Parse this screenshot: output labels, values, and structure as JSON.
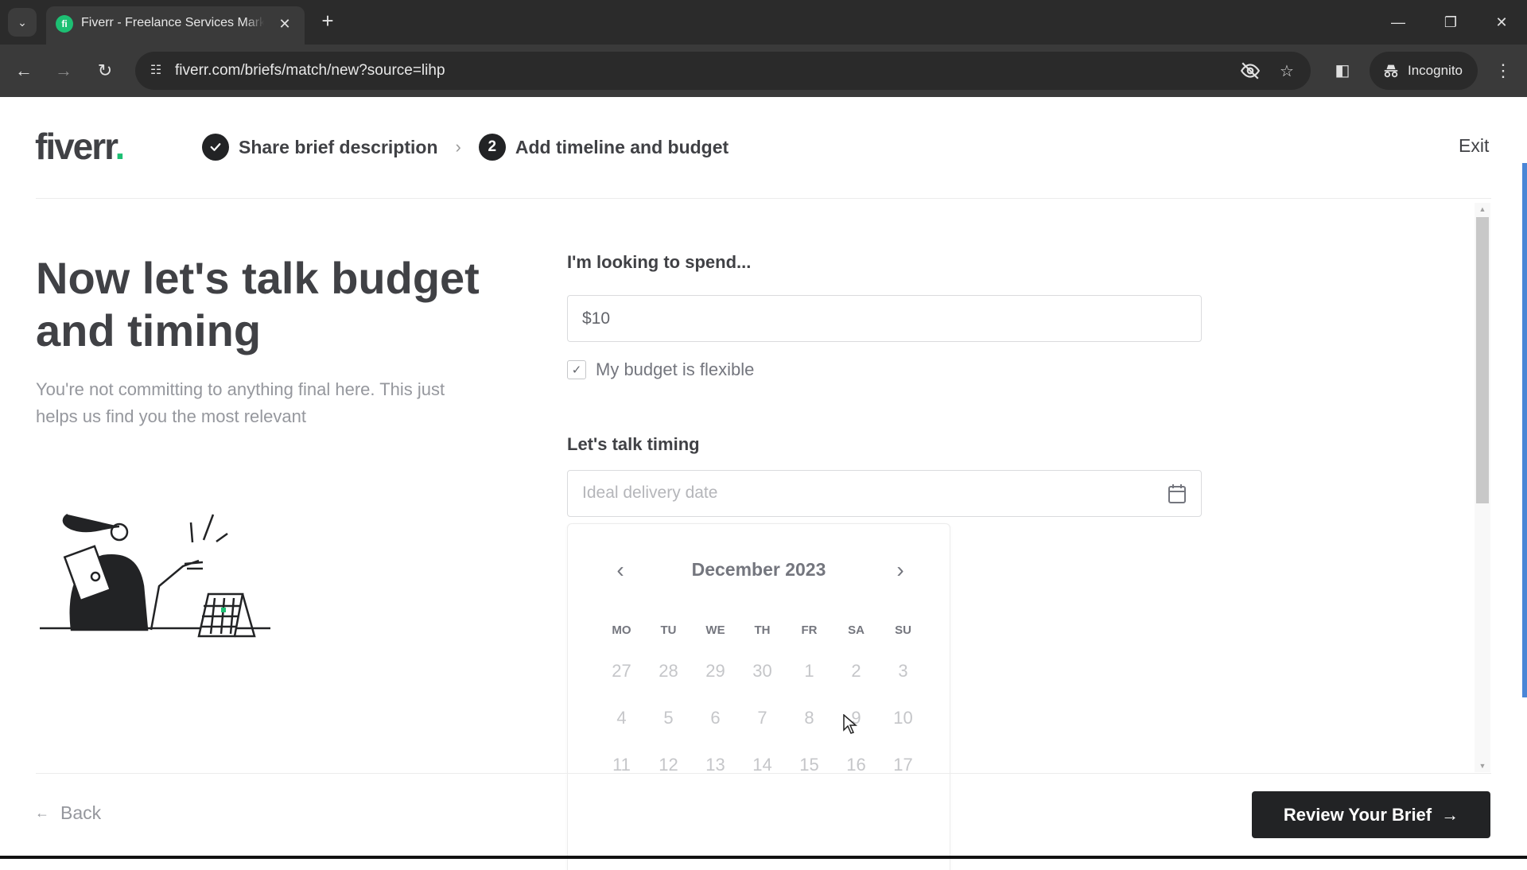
{
  "browser": {
    "tab_title": "Fiverr - Freelance Services Marketplace",
    "favicon_letter": "fi",
    "url": "fiverr.com/briefs/match/new?source=lihp",
    "profile_label": "Incognito",
    "icons": {
      "tab_list": "chevron-down-icon",
      "close_tab": "close-icon",
      "new_tab": "plus-icon",
      "back": "arrow-left-icon",
      "forward": "arrow-right-icon",
      "reload": "reload-icon",
      "site_info": "tune-icon",
      "tracking": "eye-off-icon",
      "bookmark": "star-icon",
      "side_panel": "side-panel-icon",
      "menu": "kebab-menu-icon"
    }
  },
  "header": {
    "logo_text": "fiverr",
    "logo_dot": ".",
    "steps": [
      {
        "badge": "✓",
        "label": "Share brief description",
        "status": "completed"
      },
      {
        "badge": "2",
        "label": "Add timeline and budget",
        "status": "current"
      }
    ],
    "step_separator": "›",
    "exit_label": "Exit"
  },
  "intro": {
    "heading": "Now let's talk budget and timing",
    "subtext": "You're not committing to anything final here. This just helps us find you the most relevant"
  },
  "budget": {
    "label": "I'm looking to spend...",
    "value": "$10",
    "flexible_label": "My budget is flexible",
    "flexible_checked": true
  },
  "timing": {
    "label": "Let's talk timing",
    "placeholder": "Ideal delivery date",
    "calendar": {
      "month_label": "December 2023",
      "weekdays": [
        "MO",
        "TU",
        "WE",
        "TH",
        "FR",
        "SA",
        "SU"
      ],
      "weeks": [
        [
          "27",
          "28",
          "29",
          "30",
          "1",
          "2",
          "3"
        ],
        [
          "4",
          "5",
          "6",
          "7",
          "8",
          "9",
          "10"
        ],
        [
          "11",
          "12",
          "13",
          "14",
          "15",
          "16",
          "17"
        ]
      ]
    }
  },
  "footer": {
    "back_label": "Back",
    "review_label": "Review Your Brief"
  },
  "colors": {
    "brand_green": "#1dbf73",
    "primary_dark": "#222325",
    "text_dark": "#404145",
    "text_muted": "#95979d",
    "scroll_accent": "#4a86d6"
  }
}
